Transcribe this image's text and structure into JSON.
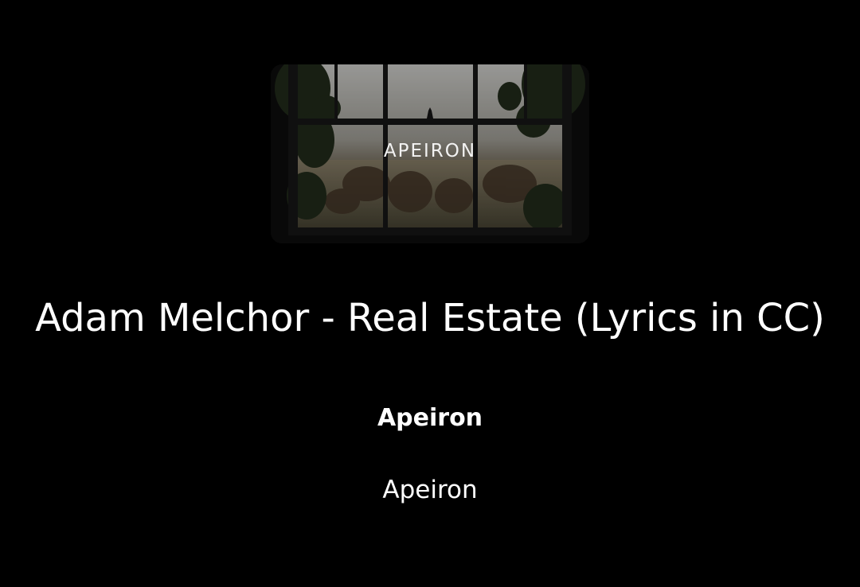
{
  "media": {
    "artwork_label": "APEIRON",
    "title": "Adam Melchor - Real Estate (Lyrics in CC)",
    "channel": "Apeiron",
    "subtitle": "Apeiron"
  },
  "colors": {
    "background": "#000000",
    "text": "#ffffff"
  }
}
